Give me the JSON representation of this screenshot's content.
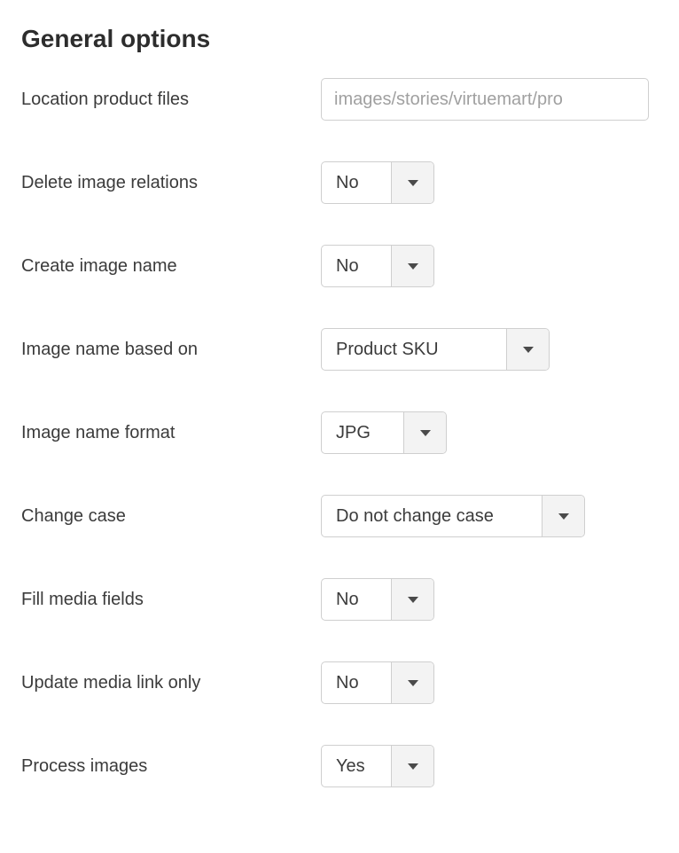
{
  "heading": "General options",
  "fields": {
    "location_product_files": {
      "label": "Location product files",
      "placeholder": "images/stories/virtuemart/pro"
    },
    "delete_image_relations": {
      "label": "Delete image relations",
      "value": "No"
    },
    "create_image_name": {
      "label": "Create image name",
      "value": "No"
    },
    "image_name_based_on": {
      "label": "Image name based on",
      "value": "Product SKU"
    },
    "image_name_format": {
      "label": "Image name format",
      "value": "JPG"
    },
    "change_case": {
      "label": "Change case",
      "value": "Do not change case"
    },
    "fill_media_fields": {
      "label": "Fill media fields",
      "value": "No"
    },
    "update_media_link_only": {
      "label": "Update media link only",
      "value": "No"
    },
    "process_images": {
      "label": "Process images",
      "value": "Yes"
    }
  }
}
